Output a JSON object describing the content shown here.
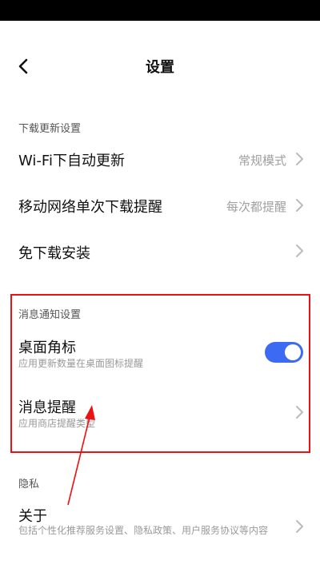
{
  "header": {
    "title": "设置"
  },
  "sections": {
    "download": {
      "label": "下载更新设置",
      "wifi": {
        "title": "Wi-Fi下自动更新",
        "value": "常规模式"
      },
      "mobile": {
        "title": "移动网络单次下载提醒",
        "value": "每次都提醒"
      },
      "free_install": {
        "title": "免下载安装"
      }
    },
    "notify": {
      "label": "消息通知设置",
      "badge": {
        "title": "桌面角标",
        "subtitle": "应用更新数量在桌面图标提醒",
        "enabled": true
      },
      "reminder": {
        "title": "消息提醒",
        "subtitle": "应用商店提醒类型"
      }
    },
    "privacy": {
      "label": "隐私",
      "about": {
        "title": "关于",
        "subtitle": "包括个性化推荐服务设置、隐私政策、用户服务协议等内容"
      }
    }
  },
  "colors": {
    "accent": "#3d6af2",
    "annotation": "#e11111"
  }
}
